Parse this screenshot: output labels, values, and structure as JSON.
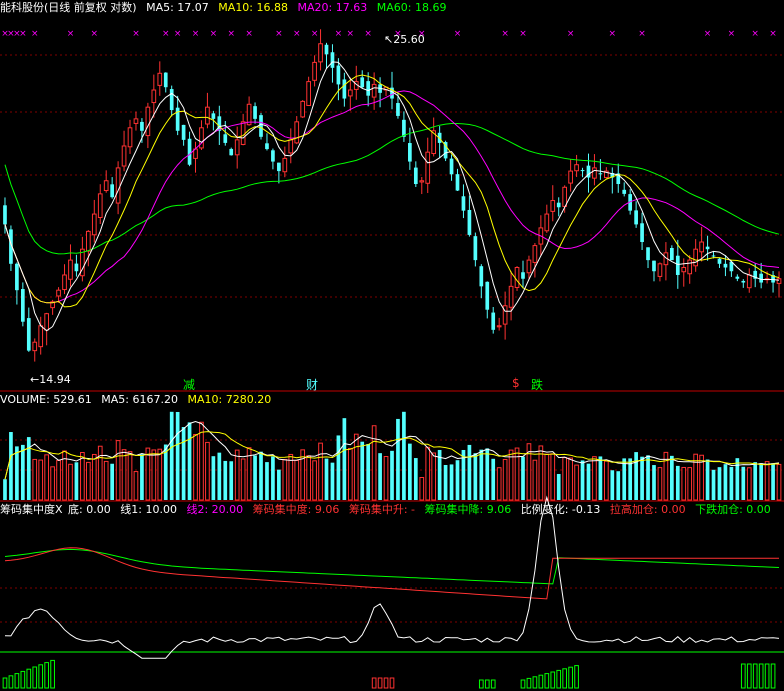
{
  "colors": {
    "ma5": "#ffffff",
    "ma10": "#ffff00",
    "ma20": "#ff00ff",
    "ma60": "#00ff00",
    "up": "#ff3232",
    "down": "#54ffff",
    "grid": "#800000",
    "separator": "#c00000"
  },
  "price_header": {
    "stock": "能科股份(日线 前复权 对数)",
    "ma5": "MA5: 17.07",
    "ma10": "MA10: 16.88",
    "ma20": "MA20: 17.63",
    "ma60": "MA60: 18.69"
  },
  "price_panel": {
    "high_label": "25.60",
    "low_label": "14.94",
    "markers": [
      {
        "text": "减",
        "color": "#00ff00"
      },
      {
        "text": "财",
        "color": "#54ffff"
      },
      {
        "text": "$",
        "color": "#ff3232"
      },
      {
        "text": "跌",
        "color": "#00ff00"
      }
    ]
  },
  "volume_header": {
    "volume": "VOLUME: 529.61",
    "ma5": "MA5: 6167.20",
    "ma10": "MA10: 7280.20"
  },
  "indicator_header": {
    "name": "筹码集中度X",
    "bottom": "底: 0.00",
    "line1": "线1: 10.00",
    "line2": "线2: 20.00",
    "concentration": "筹码集中度: 9.06",
    "conc_up": "筹码集中升: -",
    "conc_down": "筹码集中降: 9.06",
    "ratio": "比例变化: -0.13",
    "raise": "拉高加仓: 0.00",
    "fall": "下跌加仓: 0.00"
  },
  "chart_data": {
    "type": "candlestick",
    "x_index": [
      0,
      1,
      2,
      3,
      4,
      5,
      6,
      7,
      8,
      9,
      10,
      11,
      12,
      13,
      14,
      15,
      16,
      17,
      18,
      19,
      20,
      21,
      22,
      23,
      24,
      25,
      26,
      27,
      28,
      29,
      30,
      31,
      32,
      33,
      34,
      35,
      36,
      37,
      38,
      39,
      40,
      41,
      42,
      43,
      44,
      45,
      46,
      47,
      48,
      49,
      50,
      51,
      52,
      53,
      54,
      55,
      56,
      57,
      58,
      59,
      60,
      61,
      62,
      63,
      64,
      65,
      66,
      67,
      68,
      69,
      70,
      71,
      72,
      73,
      74,
      75,
      76,
      77,
      78,
      79,
      80,
      81,
      82,
      83,
      84,
      85,
      86,
      87,
      88,
      89,
      90,
      91,
      92,
      93,
      94,
      95,
      96,
      97,
      98,
      99,
      100,
      101,
      102,
      103,
      104,
      105,
      106,
      107,
      108,
      109,
      110,
      111,
      112,
      113,
      114,
      115,
      116,
      117,
      118,
      119,
      120,
      121,
      122,
      123,
      124,
      125,
      126,
      127,
      128,
      129,
      130
    ],
    "close": [
      18.6,
      17.5,
      16.8,
      16.0,
      15.3,
      15.5,
      15.9,
      16.2,
      16.5,
      16.8,
      17.2,
      17.6,
      17.3,
      17.9,
      18.4,
      18.9,
      19.5,
      19.9,
      19.4,
      20.3,
      21.0,
      21.6,
      21.9,
      21.5,
      22.3,
      22.9,
      23.5,
      23.0,
      22.2,
      21.5,
      21.2,
      20.4,
      20.9,
      21.6,
      22.3,
      21.9,
      21.5,
      21.1,
      20.7,
      21.2,
      21.8,
      22.4,
      21.9,
      21.3,
      20.9,
      20.5,
      20.2,
      20.6,
      21.2,
      21.8,
      22.5,
      23.2,
      23.9,
      24.6,
      24.2,
      23.7,
      23.1,
      22.6,
      22.9,
      23.2,
      23.0,
      22.7,
      23.1,
      22.8,
      23.0,
      22.6,
      22.0,
      21.3,
      20.5,
      19.8,
      19.9,
      20.8,
      21.5,
      21.1,
      20.6,
      20.1,
      19.6,
      19.0,
      18.3,
      17.6,
      16.9,
      16.3,
      15.8,
      15.9,
      16.4,
      16.9,
      17.4,
      17.1,
      17.6,
      18.0,
      18.5,
      18.9,
      19.3,
      19.1,
      19.7,
      20.2,
      20.4,
      20.2,
      20.0,
      20.3,
      20.1,
      20.2,
      20.0,
      19.8,
      19.5,
      19.0,
      18.6,
      18.1,
      17.6,
      17.3,
      17.5,
      17.8,
      17.6,
      17.2,
      17.4,
      17.6,
      17.9,
      18.1,
      17.9,
      17.7,
      17.5,
      17.4,
      17.3,
      17.1,
      17.0,
      17.2,
      17.1,
      17.0,
      17.1,
      17.0,
      17.1
    ],
    "price_ylim": [
      14.94,
      25.6
    ],
    "volume_ylim": [
      0,
      12000
    ],
    "indicator_ylim": [
      0,
      20
    ],
    "series": [
      {
        "name": "MA5",
        "color": "#ffffff"
      },
      {
        "name": "MA10",
        "color": "#ffff00"
      },
      {
        "name": "MA20",
        "color": "#ff00ff"
      },
      {
        "name": "MA60",
        "color": "#00ff00"
      }
    ]
  }
}
